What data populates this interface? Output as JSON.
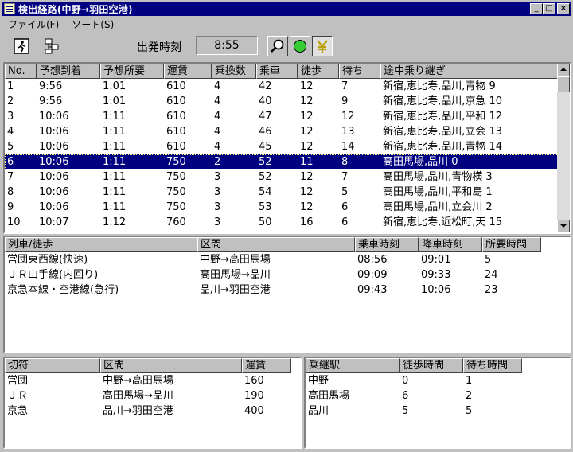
{
  "window": {
    "title": "検出経路(中野→羽田空港)"
  },
  "menu": [
    {
      "label": "ファイル(F)"
    },
    {
      "label": "ソート(S)"
    }
  ],
  "toolbar": {
    "depart_label": "出発時刻",
    "depart_time": "8:55",
    "icons": [
      "walk-icon",
      "route-icon",
      "search-icon",
      "green-circle-icon",
      "yen-icon"
    ]
  },
  "routes": {
    "columns": [
      "No.",
      "予想到着",
      "予想所要",
      "運賃",
      "乗換数",
      "乗車",
      "徒歩",
      "待ち",
      "途中乗り継ぎ"
    ],
    "rows": [
      [
        "1",
        "9:56",
        "1:01",
        "610",
        "4",
        "42",
        "12",
        "7",
        "新宿,恵比寿,品川,青物 9"
      ],
      [
        "2",
        "9:56",
        "1:01",
        "610",
        "4",
        "40",
        "12",
        "9",
        "新宿,恵比寿,品川,京急 10"
      ],
      [
        "3",
        "10:06",
        "1:11",
        "610",
        "4",
        "47",
        "12",
        "12",
        "新宿,恵比寿,品川,平和 12"
      ],
      [
        "4",
        "10:06",
        "1:11",
        "610",
        "4",
        "46",
        "12",
        "13",
        "新宿,恵比寿,品川,立会 13"
      ],
      [
        "5",
        "10:06",
        "1:11",
        "610",
        "4",
        "45",
        "12",
        "14",
        "新宿,恵比寿,品川,青物 14"
      ],
      [
        "6",
        "10:06",
        "1:11",
        "750",
        "2",
        "52",
        "11",
        "8",
        "高田馬場,品川         0"
      ],
      [
        "7",
        "10:06",
        "1:11",
        "750",
        "3",
        "52",
        "12",
        "7",
        "高田馬場,品川,青物横 3"
      ],
      [
        "8",
        "10:06",
        "1:11",
        "750",
        "3",
        "54",
        "12",
        "5",
        "高田馬場,品川,平和島 1"
      ],
      [
        "9",
        "10:06",
        "1:11",
        "750",
        "3",
        "53",
        "12",
        "6",
        "高田馬場,品川,立会川 2"
      ],
      [
        "10",
        "10:07",
        "1:12",
        "760",
        "3",
        "50",
        "16",
        "6",
        "新宿,恵比寿,近松町,天 15"
      ]
    ],
    "selected_index": 5
  },
  "legs": {
    "columns": [
      "列車/徒歩",
      "区間",
      "乗車時刻",
      "降車時刻",
      "所要時間"
    ],
    "rows": [
      [
        "営団東西線(快速)",
        "中野→高田馬場",
        "08:56",
        "09:01",
        "5"
      ],
      [
        "ＪＲ山手線(内回り)",
        "高田馬場→品川",
        "09:09",
        "09:33",
        "24"
      ],
      [
        "京急本線・空港線(急行)",
        "品川→羽田空港",
        "09:43",
        "10:06",
        "23"
      ]
    ]
  },
  "fares": {
    "columns": [
      "切符",
      "区間",
      "運賃"
    ],
    "rows": [
      [
        "営団",
        "中野→高田馬場",
        "160"
      ],
      [
        "ＪＲ",
        "高田馬場→品川",
        "190"
      ],
      [
        "京急",
        "品川→羽田空港",
        "400"
      ]
    ]
  },
  "transfers": {
    "columns": [
      "乗継駅",
      "徒歩時間",
      "待ち時間"
    ],
    "rows": [
      [
        "中野",
        "0",
        "1"
      ],
      [
        "高田馬場",
        "6",
        "2"
      ],
      [
        "品川",
        "5",
        "5"
      ]
    ]
  },
  "colors": {
    "selection": "#000080",
    "titlebar": "#000080"
  }
}
